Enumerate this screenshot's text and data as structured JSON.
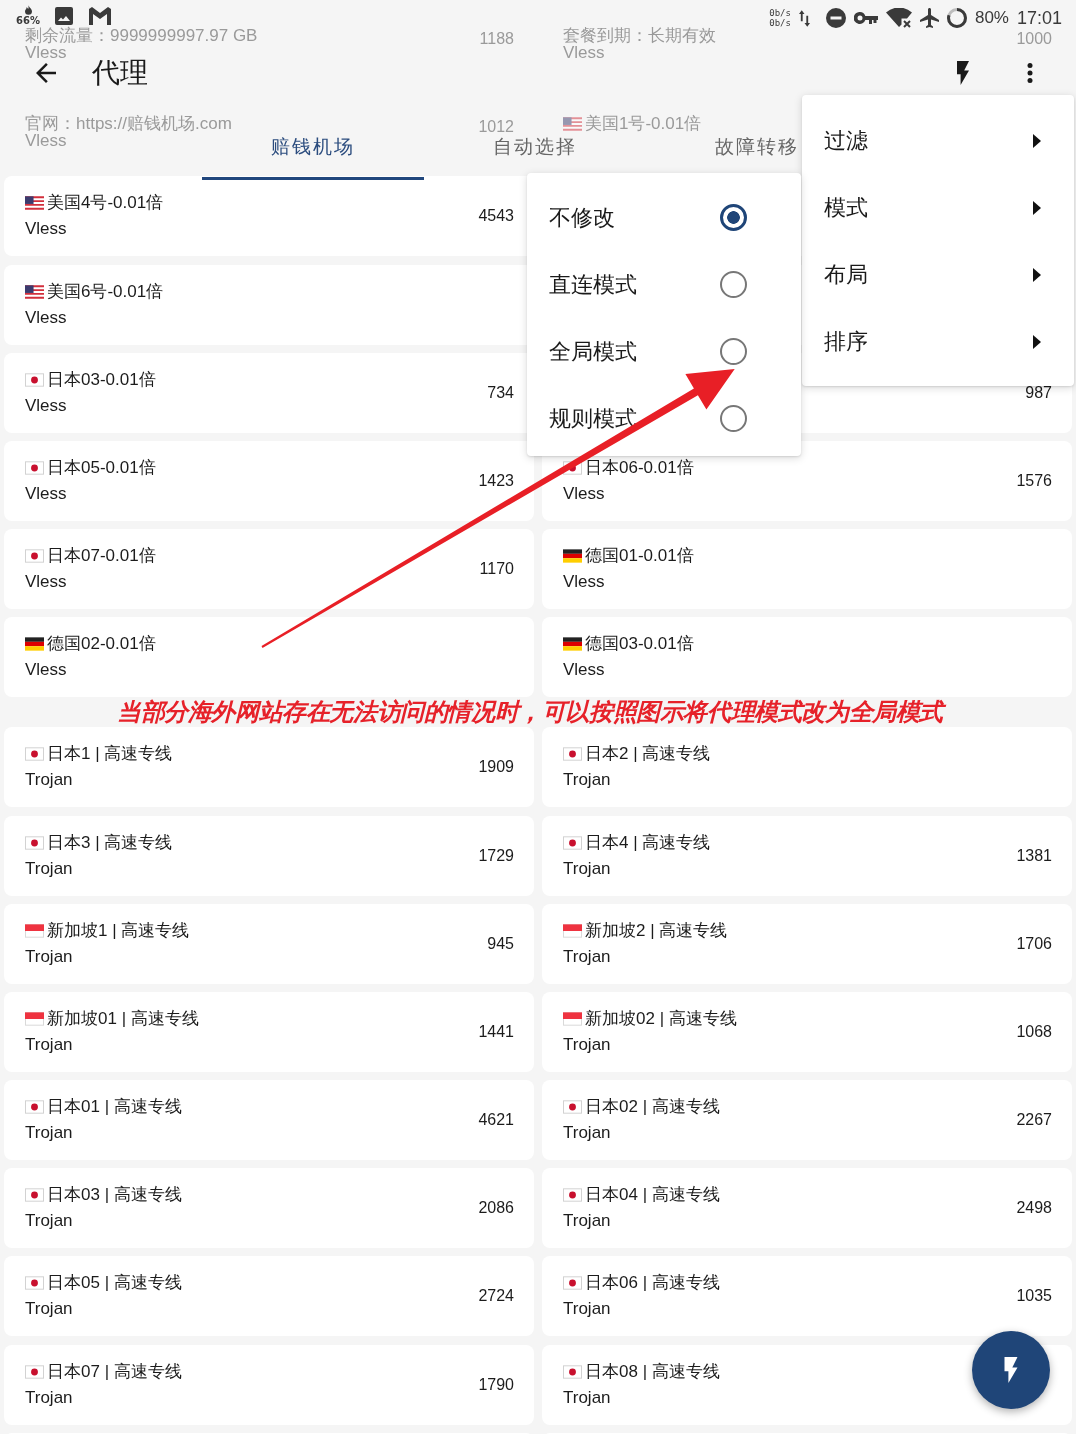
{
  "status_bar": {
    "notification_text": "66%",
    "network_speed": [
      "0b/s",
      "0b/s"
    ],
    "battery": "80%",
    "time": "17:01"
  },
  "app_bar": {
    "title": "代理"
  },
  "tabs": [
    {
      "label": "赔钱机场",
      "selected": true
    },
    {
      "label": "自动选择",
      "selected": false
    },
    {
      "label": "故障转移",
      "selected": false
    }
  ],
  "under_header": {
    "rows": [
      {
        "left": {
          "title": "剩余流量：9999999997.97 GB",
          "subtitle": "Vless",
          "delay": "1188"
        },
        "right": {
          "title": "套餐到期：长期有效",
          "subtitle": "Vless",
          "delay": "1000"
        }
      },
      {
        "left": {
          "title": "官网：https://赔钱机场.com",
          "subtitle": "Vless",
          "delay": "1012"
        },
        "right": {
          "kind": "us",
          "title": "美国1号-0.01倍"
        }
      }
    ]
  },
  "list": {
    "rows": [
      {
        "kind": "pair",
        "left": {
          "kind": "us",
          "title": "美国4号-0.01倍",
          "subtitle": "Vless",
          "delay": "4543"
        }
      },
      {
        "kind": "pair",
        "left": {
          "kind": "us",
          "title": "美国6号-0.01倍",
          "subtitle": "Vless"
        }
      },
      {
        "kind": "pair",
        "left": {
          "kind": "jp",
          "title": "日本03-0.01倍",
          "subtitle": "Vless",
          "delay": "734"
        },
        "right": {
          "delay": "987"
        }
      },
      {
        "kind": "pair",
        "left": {
          "kind": "jp",
          "title": "日本05-0.01倍",
          "subtitle": "Vless",
          "delay": "1423"
        },
        "right": {
          "kind": "jp",
          "title": "日本06-0.01倍",
          "subtitle": "Vless",
          "delay": "1576"
        }
      },
      {
        "kind": "pair",
        "left": {
          "kind": "jp",
          "title": "日本07-0.01倍",
          "subtitle": "Vless",
          "delay": "1170"
        },
        "right": {
          "kind": "de",
          "title": "德国01-0.01倍",
          "subtitle": "Vless"
        }
      },
      {
        "kind": "pair",
        "left": {
          "kind": "de",
          "title": "德国02-0.01倍",
          "subtitle": "Vless"
        },
        "right": {
          "kind": "de",
          "title": "德国03-0.01倍",
          "subtitle": "Vless"
        }
      },
      {
        "kind": "annotation",
        "text": "当部分海外网站存在无法访问的情况时，可以按照图示将代理模式改为全局模式"
      },
      {
        "kind": "pair",
        "left": {
          "kind": "jp",
          "title": "日本1 | 高速专线",
          "subtitle": "Trojan",
          "delay": "1909"
        },
        "right": {
          "kind": "jp",
          "title": "日本2 | 高速专线",
          "subtitle": "Trojan"
        }
      },
      {
        "kind": "pair",
        "left": {
          "kind": "jp",
          "title": "日本3 | 高速专线",
          "subtitle": "Trojan",
          "delay": "1729"
        },
        "right": {
          "kind": "jp",
          "title": "日本4 | 高速专线",
          "subtitle": "Trojan",
          "delay": "1381"
        }
      },
      {
        "kind": "pair",
        "left": {
          "kind": "sg",
          "title": "新加坡1 | 高速专线",
          "subtitle": "Trojan",
          "delay": "945"
        },
        "right": {
          "kind": "sg",
          "title": "新加坡2 | 高速专线",
          "subtitle": "Trojan",
          "delay": "1706"
        }
      },
      {
        "kind": "pair",
        "left": {
          "kind": "sg",
          "title": "新加坡01 | 高速专线",
          "subtitle": "Trojan",
          "delay": "1441"
        },
        "right": {
          "kind": "sg",
          "title": "新加坡02 | 高速专线",
          "subtitle": "Trojan",
          "delay": "1068"
        }
      },
      {
        "kind": "pair",
        "left": {
          "kind": "jp",
          "title": "日本01 | 高速专线",
          "subtitle": "Trojan",
          "delay": "4621"
        },
        "right": {
          "kind": "jp",
          "title": "日本02 | 高速专线",
          "subtitle": "Trojan",
          "delay": "2267"
        }
      },
      {
        "kind": "pair",
        "left": {
          "kind": "jp",
          "title": "日本03 | 高速专线",
          "subtitle": "Trojan",
          "delay": "2086"
        },
        "right": {
          "kind": "jp",
          "title": "日本04 | 高速专线",
          "subtitle": "Trojan",
          "delay": "2498"
        }
      },
      {
        "kind": "pair",
        "left": {
          "kind": "jp",
          "title": "日本05 | 高速专线",
          "subtitle": "Trojan",
          "delay": "2724"
        },
        "right": {
          "kind": "jp",
          "title": "日本06 | 高速专线",
          "subtitle": "Trojan",
          "delay": "1035"
        }
      },
      {
        "kind": "pair",
        "left": {
          "kind": "jp",
          "title": "日本07 | 高速专线",
          "subtitle": "Trojan",
          "delay": "1790"
        },
        "right": {
          "kind": "jp",
          "title": "日本08 | 高速专线",
          "subtitle": "Trojan"
        }
      }
    ]
  },
  "overflow_menu": {
    "items": [
      {
        "label": "过滤",
        "has_submenu": true
      },
      {
        "label": "模式",
        "has_submenu": true
      },
      {
        "label": "布局",
        "has_submenu": true
      },
      {
        "label": "排序",
        "has_submenu": true
      }
    ]
  },
  "mode_menu": {
    "items": [
      {
        "label": "不修改",
        "selected": true
      },
      {
        "label": "直连模式",
        "selected": false
      },
      {
        "label": "全局模式",
        "selected": false
      },
      {
        "label": "规则模式",
        "selected": false
      }
    ]
  }
}
